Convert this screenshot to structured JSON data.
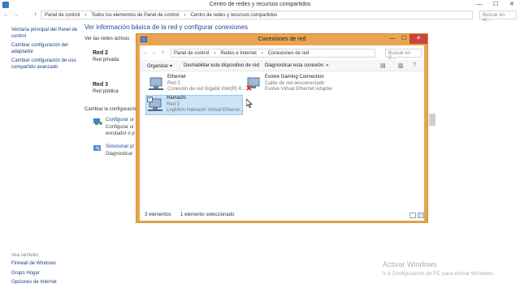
{
  "bg_window": {
    "title": "Centro de redes y recursos compartidos",
    "controls": [
      "—",
      "☐",
      "✕"
    ],
    "nav": [
      "←",
      "→",
      "↑"
    ],
    "breadcrumb": [
      "Panel de control",
      "›",
      "Todos los elementos de Panel de control",
      "›",
      "Centro de redes y recursos compartidos"
    ],
    "refresh_icon": "refresh-icon",
    "search_placeholder": "Buscar en el...",
    "left_links": [
      "Ventana principal del Panel de control",
      "Cambiar configuración del adaptador",
      "Cambiar configuración de uso compartido avanzado"
    ],
    "see_also": "Vea también",
    "bottom_links": [
      "Firewall de Windows",
      "Grupo Hogar",
      "Opciones de Internet"
    ],
    "main_title": "Ver información básica de la red y configurar conexiones",
    "active_networks_label": "Ver las redes activas",
    "networks": [
      {
        "name": "Red 2",
        "type": "Red privada"
      },
      {
        "name": "Red 3",
        "type": "Red pública"
      }
    ],
    "change_settings_label": "Cambiar la configuración",
    "tasks": [
      {
        "link": "Configurar ur",
        "desc1": "Configurar ur",
        "desc2": "enrutador o p"
      },
      {
        "link": "Solucionar pr",
        "desc1": "Diagnosticar"
      }
    ]
  },
  "fg_window": {
    "title": "Conexiones de red",
    "controls": [
      "—",
      "☐",
      "✕"
    ],
    "nav": [
      "←",
      "→",
      "↑"
    ],
    "breadcrumb": [
      "Panel de control",
      "›",
      "Redes e Internet",
      "›",
      "Conexiones de red"
    ],
    "search_placeholder": "Buscar en C...",
    "toolbar": {
      "organize": "Organizar ▾",
      "disable": "Deshabilitar este dispositivo de red",
      "diagnose": "Diagnosticar esta conexión",
      "more": "»"
    },
    "connections": [
      {
        "name": "Ethernet",
        "line2": "Red 2",
        "line3": "Conexión de red Gigabit Intel(R) 8...",
        "selected": false,
        "disconnected": false
      },
      {
        "name": "Evolve Gaming Connection",
        "line2": "Cable de red desconectado",
        "line3": "Evolve Virtual Ethernet Adapter",
        "selected": false,
        "disconnected": true
      },
      {
        "name": "Hamachi",
        "line2": "Red 3",
        "line3": "LogMeIn Hamachi Virtual Etherne...",
        "selected": true,
        "disconnected": false
      }
    ],
    "status": {
      "count": "3 elementos",
      "selected": "1 elemento seleccionado"
    }
  },
  "watermark": {
    "title": "Activar Windows",
    "subtitle": "Ir a Configuración de PC para activar Windows."
  },
  "colors": {
    "window_accent": "#e8a452",
    "close_button": "#c9443a",
    "link": "#1e4a9c",
    "selection": "#cce4f7"
  }
}
